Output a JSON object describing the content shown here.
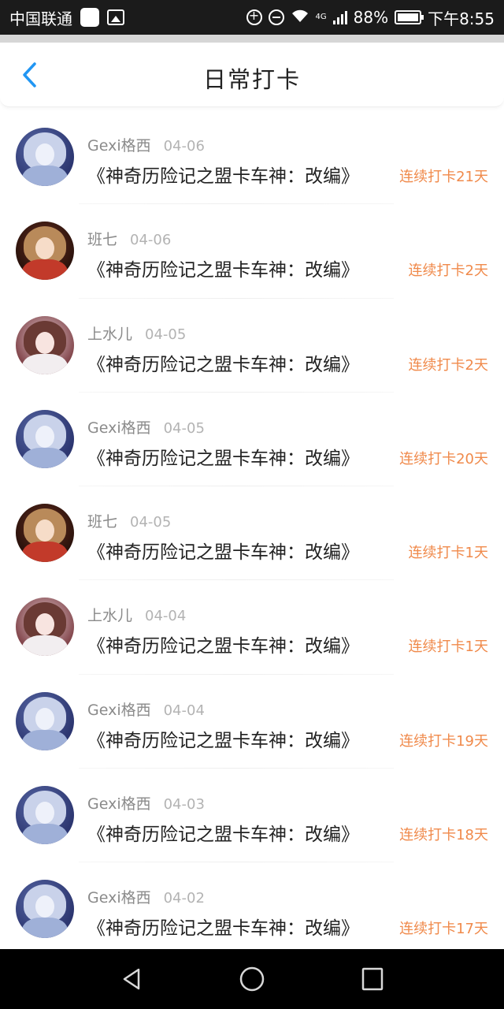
{
  "status_bar": {
    "carrier": "中国联通",
    "network": "4G",
    "battery": "88%",
    "time": "下午8:55"
  },
  "header": {
    "title": "日常打卡"
  },
  "icons": {
    "back": "chevron-left-icon",
    "nav_back": "triangle-back-icon",
    "nav_home": "circle-home-icon",
    "nav_recent": "square-recent-icon"
  },
  "colors": {
    "accent": "#2196f3",
    "streak": "#f08a4b"
  },
  "entries": [
    {
      "user": "Gexi格西",
      "date": "04-06",
      "book": "《神奇历险记之盟卡车神：改编》",
      "streak": "连续打卡21天",
      "avatar": "blue"
    },
    {
      "user": "班七",
      "date": "04-06",
      "book": "《神奇历险记之盟卡车神：改编》",
      "streak": "连续打卡2天",
      "avatar": "brown"
    },
    {
      "user": "上水儿",
      "date": "04-05",
      "book": "《神奇历险记之盟卡车神：改编》",
      "streak": "连续打卡2天",
      "avatar": "pink"
    },
    {
      "user": "Gexi格西",
      "date": "04-05",
      "book": "《神奇历险记之盟卡车神：改编》",
      "streak": "连续打卡20天",
      "avatar": "blue"
    },
    {
      "user": "班七",
      "date": "04-05",
      "book": "《神奇历险记之盟卡车神：改编》",
      "streak": "连续打卡1天",
      "avatar": "brown"
    },
    {
      "user": "上水儿",
      "date": "04-04",
      "book": "《神奇历险记之盟卡车神：改编》",
      "streak": "连续打卡1天",
      "avatar": "pink"
    },
    {
      "user": "Gexi格西",
      "date": "04-04",
      "book": "《神奇历险记之盟卡车神：改编》",
      "streak": "连续打卡19天",
      "avatar": "blue"
    },
    {
      "user": "Gexi格西",
      "date": "04-03",
      "book": "《神奇历险记之盟卡车神：改编》",
      "streak": "连续打卡18天",
      "avatar": "blue"
    },
    {
      "user": "Gexi格西",
      "date": "04-02",
      "book": "《神奇历险记之盟卡车神：改编》",
      "streak": "连续打卡17天",
      "avatar": "blue"
    }
  ]
}
